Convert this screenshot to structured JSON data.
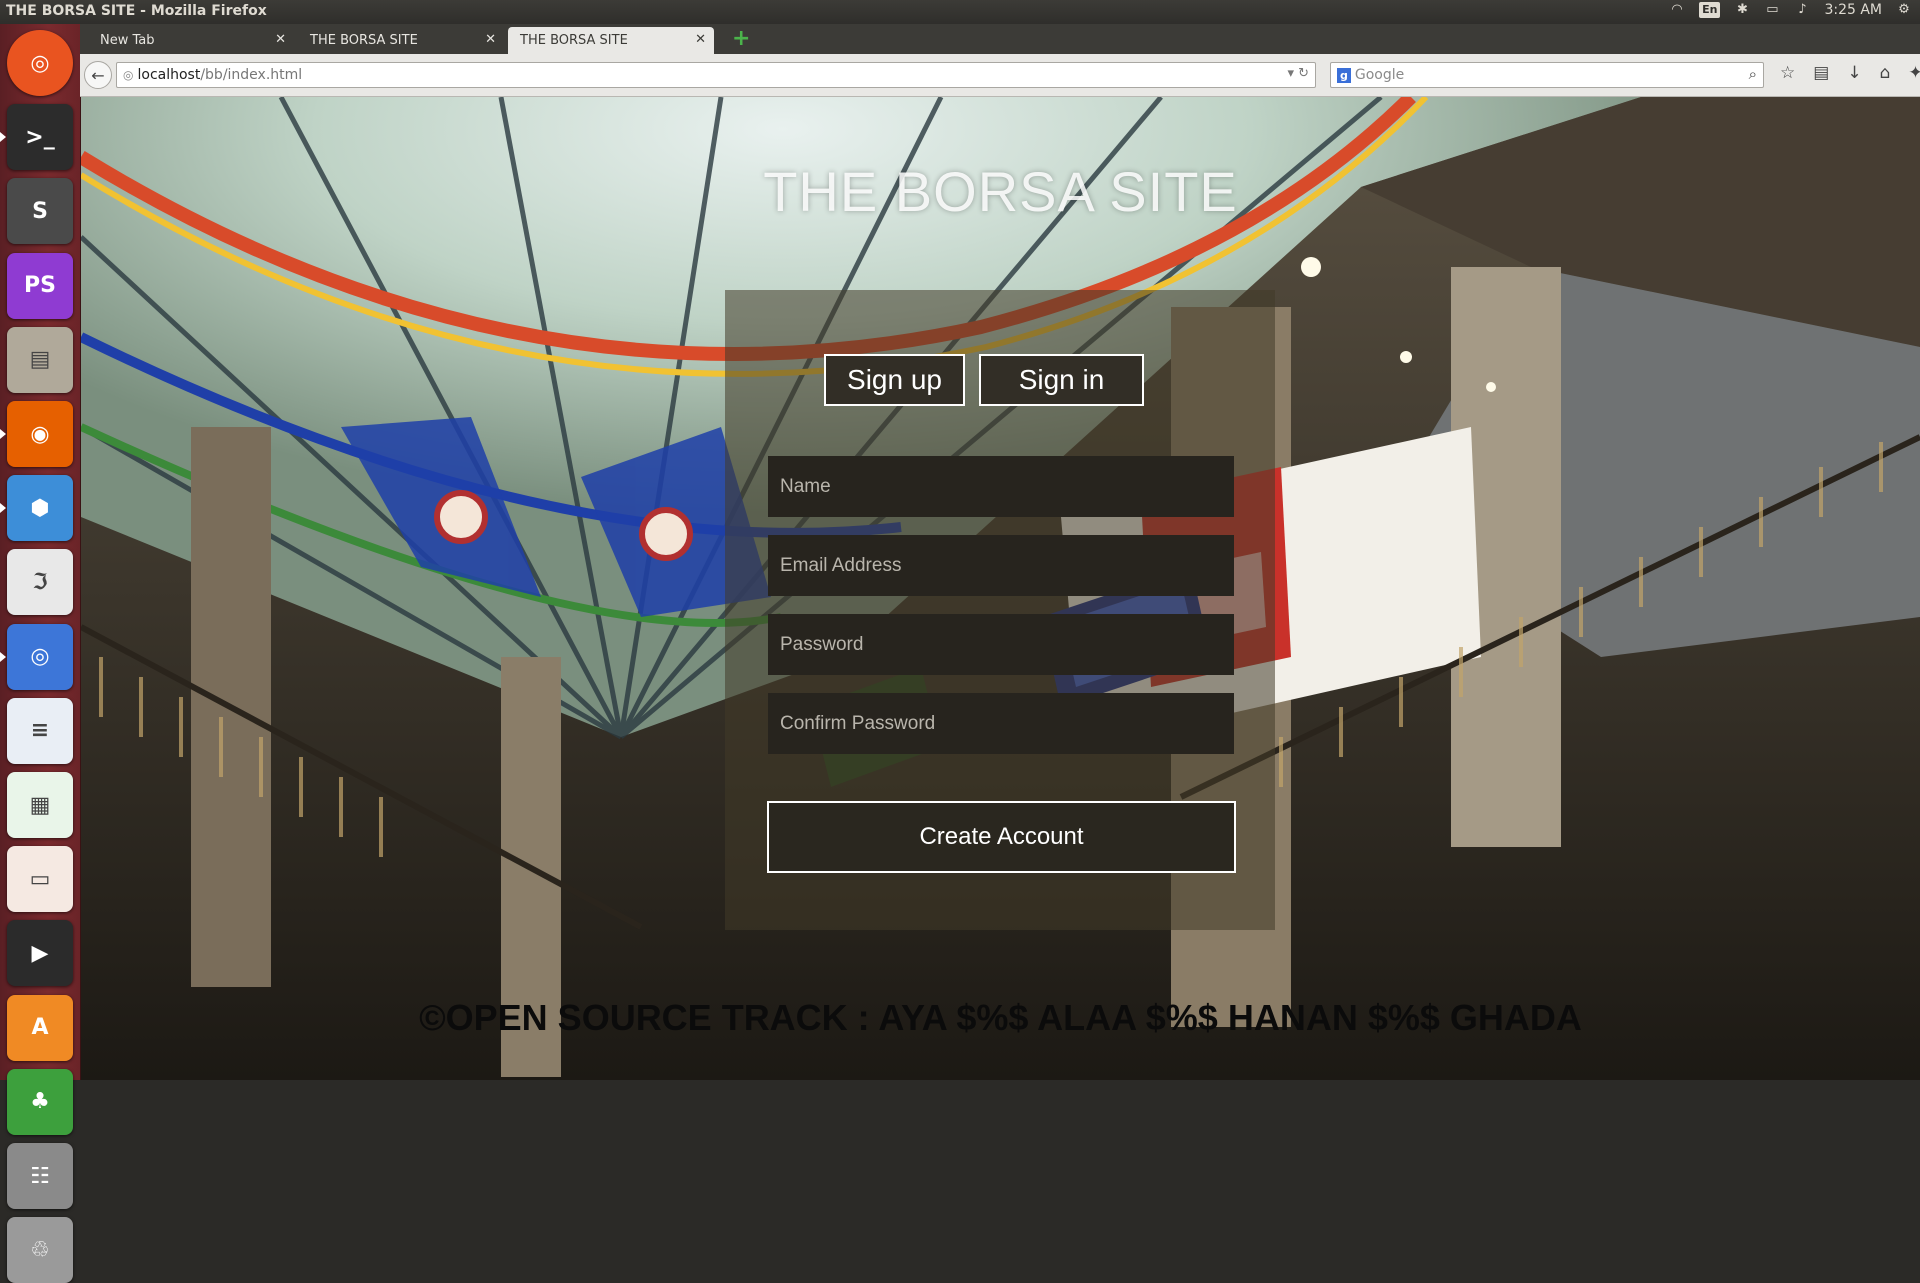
{
  "system_bar": {
    "window_title": "THE BORSA SITE - Mozilla Firefox",
    "input_language": "En",
    "clock": "3:25 AM"
  },
  "launcher": {
    "items": [
      {
        "name": "ubuntu-dash-icon",
        "color": "#e95420"
      },
      {
        "name": "terminal-icon",
        "color": "#2c2c2c"
      },
      {
        "name": "sublime-text-icon",
        "color": "#4a4a4a"
      },
      {
        "name": "phpstorm-icon",
        "color": "#8f3bd2"
      },
      {
        "name": "files-icon",
        "color": "#b0a99a"
      },
      {
        "name": "firefox-icon",
        "color": "#e66000"
      },
      {
        "name": "virtualbox-icon",
        "color": "#3d8ed8"
      },
      {
        "name": "pdf-reader-icon",
        "color": "#e8e8e8"
      },
      {
        "name": "chromium-icon",
        "color": "#3d76d8"
      },
      {
        "name": "libreoffice-writer-icon",
        "color": "#e9eef5"
      },
      {
        "name": "libreoffice-calc-icon",
        "color": "#e9f5e9"
      },
      {
        "name": "libreoffice-impress-icon",
        "color": "#f5e9e2"
      },
      {
        "name": "youtube-downloader-icon",
        "color": "#2b2b2b"
      },
      {
        "name": "software-center-icon",
        "color": "#f08a24"
      },
      {
        "name": "gnome-games-icon",
        "color": "#3da03d"
      },
      {
        "name": "workspace-switcher-icon",
        "color": "#8a8a8a"
      },
      {
        "name": "trash-icon",
        "color": "#9a9a9a"
      }
    ]
  },
  "browser": {
    "tabs": [
      {
        "label": "New Tab",
        "active": false
      },
      {
        "label": "THE BORSA SITE",
        "active": false
      },
      {
        "label": "THE BORSA SITE",
        "active": true
      }
    ],
    "url_host": "localhost",
    "url_path": "/bb/index.html",
    "search_engine_badge": "g",
    "search_placeholder": "Google"
  },
  "page": {
    "site_title": "THE BORSA SITE",
    "signup_label": "Sign up",
    "signin_label": "Sign in",
    "form": {
      "name_placeholder": "Name",
      "email_placeholder": "Email Address",
      "password_placeholder": "Password",
      "confirm_placeholder": "Confirm Password",
      "submit_label": "Create Account"
    },
    "footer": "©OPEN SOURCE TRACK : AYA $%$ ALAA $%$ HANAN $%$ GHADA"
  }
}
